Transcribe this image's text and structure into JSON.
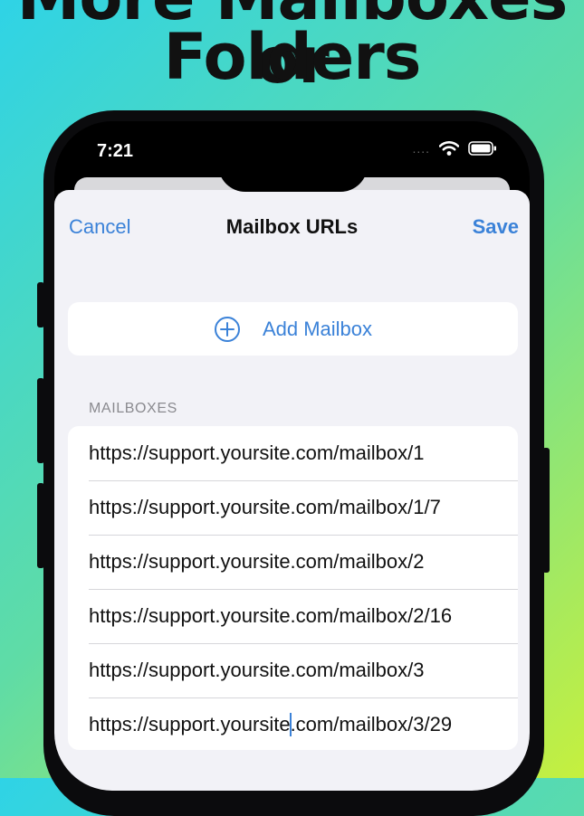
{
  "headline": {
    "line1": "More Mailboxes or",
    "line2": "Folders"
  },
  "status_bar": {
    "time": "7:21",
    "signal_dots": "....",
    "icons": [
      "wifi-icon",
      "battery-icon"
    ]
  },
  "nav": {
    "cancel_label": "Cancel",
    "title": "Mailbox URLs",
    "save_label": "Save"
  },
  "add_mailbox": {
    "label": "Add Mailbox",
    "icon": "plus-circle-icon"
  },
  "mailboxes": {
    "header": "MAILBOXES",
    "items": [
      "https://support.yoursite.com/mailbox/1",
      "https://support.yoursite.com/mailbox/1/7",
      "https://support.yoursite.com/mailbox/2",
      "https://support.yoursite.com/mailbox/2/16",
      "https://support.yoursite.com/mailbox/3"
    ],
    "editing_before_cursor": "https://support.yoursite",
    "editing_after_cursor": ".com/mailbox/3/29"
  },
  "colors": {
    "accent": "#3b82d8",
    "sheet_bg": "#f2f2f7",
    "gradient_start": "#2fd3e6",
    "gradient_end": "#c6f03e"
  }
}
